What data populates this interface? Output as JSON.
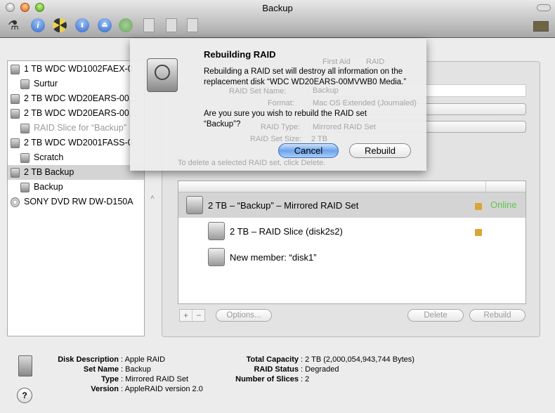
{
  "window": {
    "title": "Backup"
  },
  "toolbar": {
    "icons": [
      "microscope-icon",
      "info-icon",
      "burn-icon",
      "mount-icon",
      "eject-icon",
      "enable-journaling-icon",
      "new-image-icon",
      "convert-icon",
      "resize-image-icon",
      "log-icon"
    ]
  },
  "sidebar": {
    "items": [
      {
        "label": "1 TB WDC WD1002FAEX-0",
        "level": 0,
        "state": "normal"
      },
      {
        "label": "Surtur",
        "level": 1,
        "state": "normal"
      },
      {
        "label": "2 TB WDC WD20EARS-00...",
        "level": 0,
        "state": "normal"
      },
      {
        "label": "2 TB WDC WD20EARS-00...",
        "level": 0,
        "state": "normal"
      },
      {
        "label": "RAID Slice for “Backup”",
        "level": 1,
        "state": "dimmed"
      },
      {
        "label": "2 TB WDC WD2001FASS-0",
        "level": 0,
        "state": "normal"
      },
      {
        "label": "Scratch",
        "level": 1,
        "state": "normal"
      },
      {
        "label": "2 TB Backup",
        "level": 0,
        "state": "selected"
      },
      {
        "label": "Backup",
        "level": 1,
        "state": "normal"
      },
      {
        "label": "SONY DVD RW DW-D150A",
        "level": 0,
        "state": "normal"
      }
    ]
  },
  "raid": {
    "tabs": [
      "First Aid",
      "RAID"
    ],
    "set_name_label": "RAID Set Name:",
    "set_name": "Backup",
    "format_label": "Format:",
    "format": "Mac OS Extended (Journaled)",
    "type_label": "RAID Type:",
    "type": "Mirrored RAID Set",
    "size_label": "RAID Set Size:",
    "size": "2 TB",
    "hint": "To delete a selected RAID set, click Delete.",
    "rows": [
      {
        "label": "2 TB – “Backup” – Mirrored RAID Set",
        "status": "Online",
        "locked": true
      },
      {
        "label": "2 TB – RAID Slice (disk2s2)",
        "status": "",
        "locked": true
      },
      {
        "label": "New member: “disk1”",
        "status": "",
        "locked": false
      }
    ],
    "add": "+",
    "remove": "−",
    "options": "Options...",
    "delete": "Delete",
    "rebuild": "Rebuild",
    "online_color": "#5cc84a"
  },
  "dialog": {
    "title": "Rebuilding RAID",
    "message": "Rebuilding a RAID set will destroy all information on the replacement disk “WDC WD20EARS-00MVWB0 Media.”",
    "question": "Are you sure you wish to rebuild the RAID set “Backup”?",
    "cancel": "Cancel",
    "rebuild": "Rebuild"
  },
  "info": {
    "left": [
      {
        "k": "Disk Description",
        "v": "Apple RAID"
      },
      {
        "k": "Set Name",
        "v": "Backup"
      },
      {
        "k": "Type",
        "v": "Mirrored RAID Set"
      },
      {
        "k": "Version",
        "v": "AppleRAID version 2.0"
      }
    ],
    "right": [
      {
        "k": "Total Capacity",
        "v": "2 TB (2,000,054,943,744 Bytes)"
      },
      {
        "k": "RAID Status",
        "v": "Degraded"
      },
      {
        "k": "Number of Slices",
        "v": "2"
      }
    ],
    "help": "?"
  }
}
